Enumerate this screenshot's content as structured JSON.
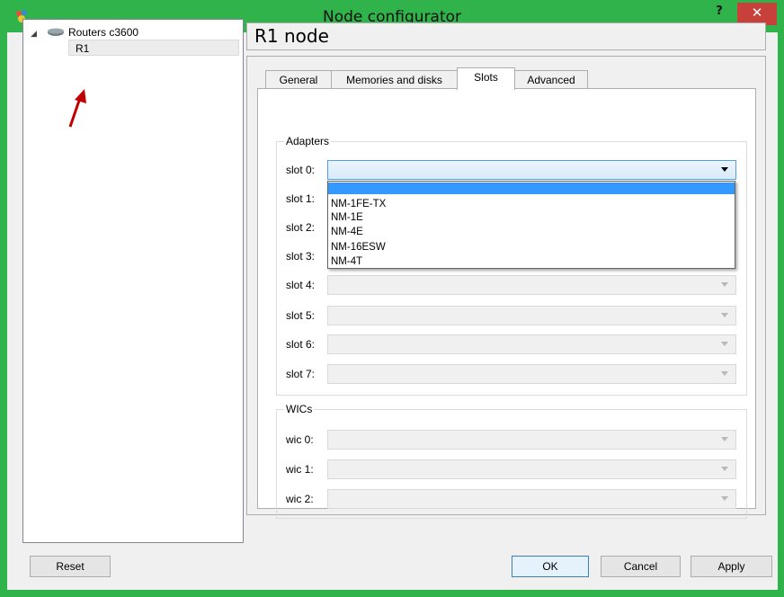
{
  "window": {
    "title": "Node configurator",
    "help_label": "?",
    "close_label": "✕"
  },
  "tree": {
    "root": {
      "expander": "◢",
      "label": "Routers c3600",
      "icon": "router-icon"
    },
    "children": [
      {
        "label": "R1",
        "selected": true
      }
    ]
  },
  "node_title": "R1 node",
  "tabs": [
    {
      "label": "General"
    },
    {
      "label": "Memories and disks"
    },
    {
      "label": "Slots",
      "active": true
    },
    {
      "label": "Advanced"
    }
  ],
  "adapters": {
    "title": "Adapters",
    "slots": [
      {
        "label": "slot 0:",
        "value": "",
        "active": true
      },
      {
        "label": "slot 1:",
        "value": ""
      },
      {
        "label": "slot 2:",
        "value": ""
      },
      {
        "label": "slot 3:",
        "value": ""
      },
      {
        "label": "slot 4:",
        "value": ""
      },
      {
        "label": "slot 5:",
        "value": ""
      },
      {
        "label": "slot 6:",
        "value": ""
      },
      {
        "label": "slot 7:",
        "value": ""
      }
    ]
  },
  "dropdown_options": [
    "",
    "NM-1FE-TX",
    "NM-1E",
    "NM-4E",
    "NM-16ESW",
    "NM-4T"
  ],
  "wics": {
    "title": "WICs",
    "slots": [
      {
        "label": "wic 0:",
        "value": ""
      },
      {
        "label": "wic 1:",
        "value": ""
      },
      {
        "label": "wic 2:",
        "value": ""
      }
    ]
  },
  "buttons": {
    "reset": "Reset",
    "ok": "OK",
    "cancel": "Cancel",
    "apply": "Apply"
  },
  "colors": {
    "titlebar": "#2fb34a",
    "close": "#c7413a",
    "selection": "#3399ff",
    "arrow": "#c00000"
  }
}
